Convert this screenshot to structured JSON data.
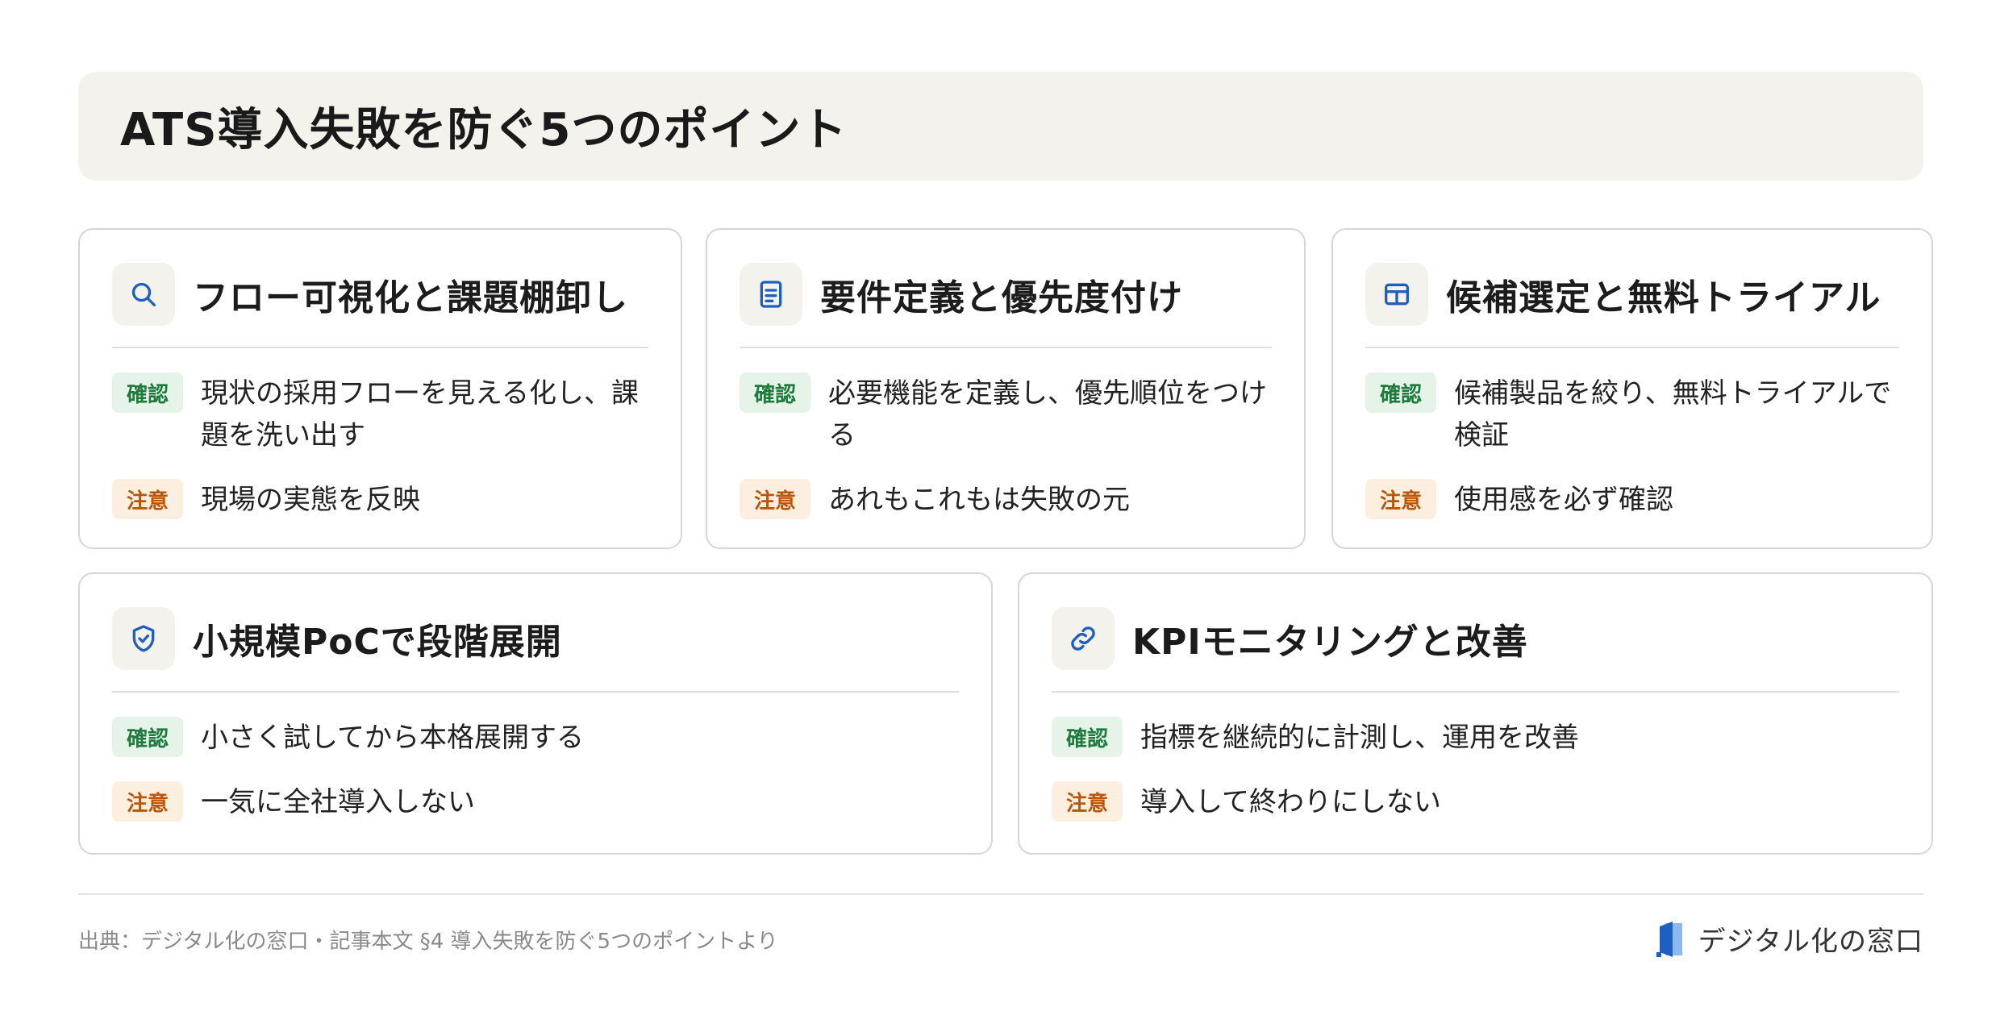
{
  "title": "ATS導入失敗を防ぐ5つのポイント",
  "labels": {
    "check": "確認",
    "warn": "注意"
  },
  "cards": [
    {
      "icon": "search-icon",
      "title": "フロー可視化と課題棚卸し",
      "check_text": "現状の採用フローを見える化し、課題を洗い出す",
      "warn_text": "現場の実態を反映"
    },
    {
      "icon": "document-icon",
      "title": "要件定義と優先度付け",
      "check_text": "必要機能を定義し、優先順位をつける",
      "warn_text": "あれもこれもは失敗の元"
    },
    {
      "icon": "table-icon",
      "title": "候補選定と無料トライアル",
      "check_text": "候補製品を絞り、無料トライアルで検証",
      "warn_text": "使用感を必ず確認"
    },
    {
      "icon": "shield-check-icon",
      "title": "小規模PoCで段階展開",
      "check_text": "小さく試してから本格展開する",
      "warn_text": "一気に全社導入しない"
    },
    {
      "icon": "link-icon",
      "title": "KPIモニタリングと改善",
      "check_text": "指標を継続的に計測し、運用を改善",
      "warn_text": "導入して終わりにしない"
    }
  ],
  "footer": {
    "source": "出典：デジタル化の窓口・記事本文 §4 導入失敗を防ぐ5つのポイントより",
    "brand": "デジタル化の窓口"
  },
  "colors": {
    "accent": "#1f5fbf",
    "check": "#1f7a3d",
    "warn": "#b8560a",
    "title_bg": "#f4f2ed"
  }
}
